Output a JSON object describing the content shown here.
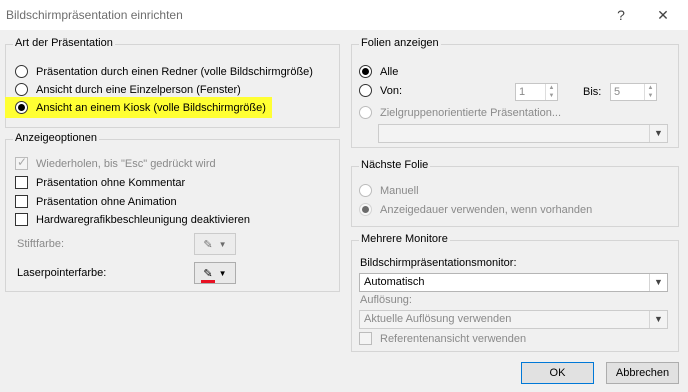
{
  "window": {
    "title": "Bildschirmpräsentation einrichten",
    "help": "?",
    "close": "✕"
  },
  "art": {
    "label": "Art der Präsentation",
    "options": [
      {
        "label": "Präsentation durch einen Redner (volle Bildschirmgröße)",
        "checked": false
      },
      {
        "label": "Ansicht durch eine Einzelperson (Fenster)",
        "checked": false
      },
      {
        "label": "Ansicht an einem Kiosk (volle Bildschirmgröße)",
        "checked": true
      }
    ],
    "highlight_color": "#ffff33"
  },
  "anzeige": {
    "label": "Anzeigeoptionen",
    "checks": [
      {
        "label": "Wiederholen, bis \"Esc\" gedrückt wird",
        "checked": true,
        "disabled": true
      },
      {
        "label": "Präsentation ohne Kommentar",
        "checked": false,
        "disabled": false
      },
      {
        "label": "Präsentation ohne Animation",
        "checked": false,
        "disabled": false
      },
      {
        "label": "Hardwaregrafikbeschleunigung deaktivieren",
        "checked": false,
        "disabled": false
      }
    ],
    "stiftfarbe_label": "Stiftfarbe:",
    "laser_label": "Laserpointerfarbe:",
    "laser_color": "#e81123"
  },
  "folien": {
    "label": "Folien anzeigen",
    "alle": "Alle",
    "von": "Von:",
    "von_value": "1",
    "bis": "Bis:",
    "bis_value": "5",
    "ziel": "Zielgruppenorientierte Präsentation..."
  },
  "naechste": {
    "label": "Nächste Folie",
    "manuell": "Manuell",
    "anzeigedauer": "Anzeigedauer verwenden, wenn vorhanden"
  },
  "monitore": {
    "label": "Mehrere Monitore",
    "monitor_label": "Bildschirmpräsentationsmonitor:",
    "monitor_value": "Automatisch",
    "aufloesung_label": "Auflösung:",
    "aufloesung_value": "Aktuelle Auflösung verwenden",
    "referent": "Referentenansicht verwenden"
  },
  "buttons": {
    "ok": "OK",
    "cancel": "Abbrechen"
  }
}
